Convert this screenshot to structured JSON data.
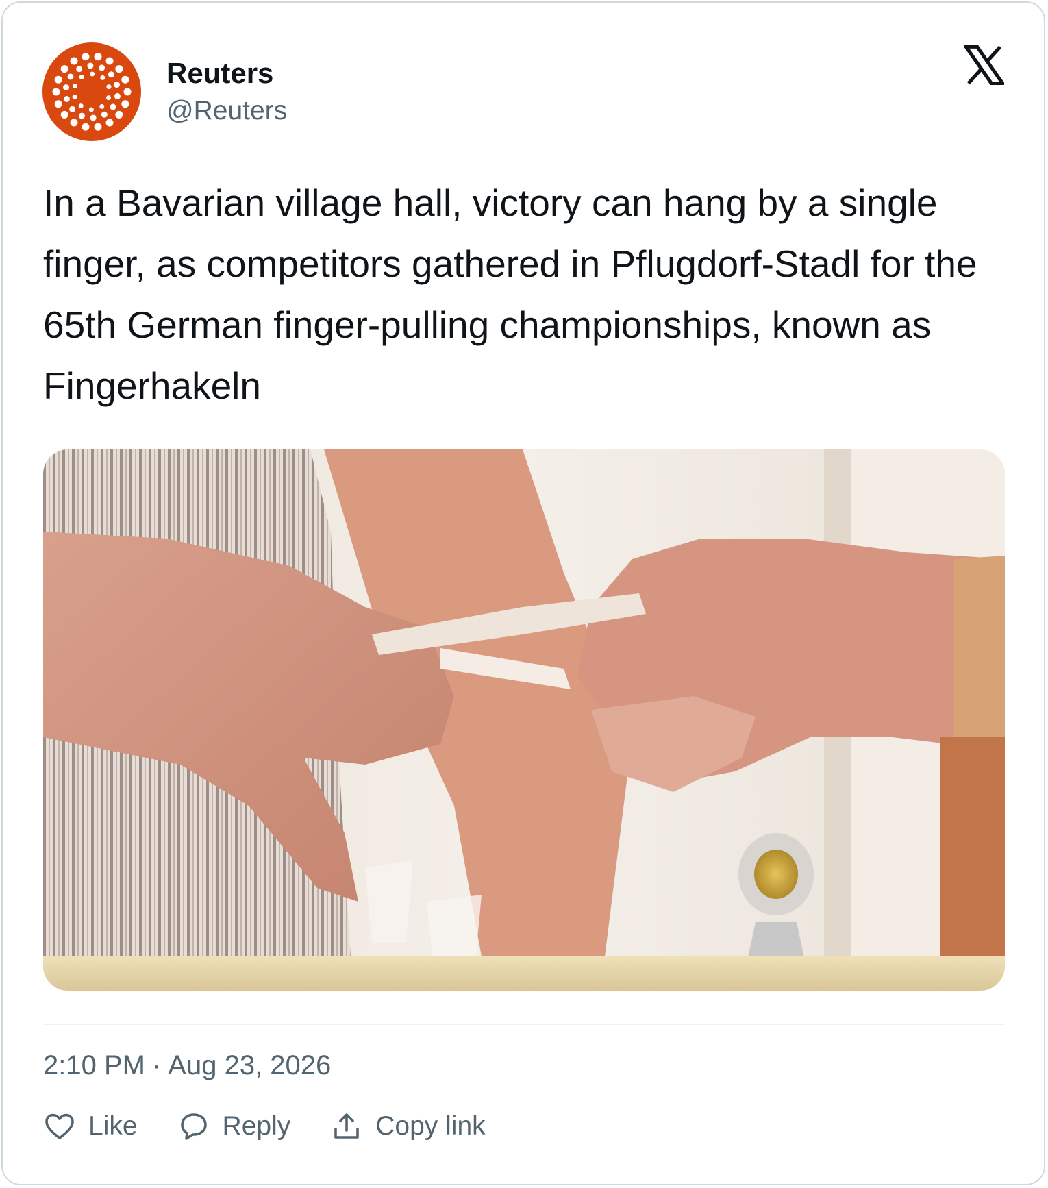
{
  "author": {
    "name": "Reuters",
    "handle": "@Reuters",
    "avatar_icon": "reuters-dots-logo",
    "avatar_color": "#d9480f"
  },
  "platform_icon": "x-logo-icon",
  "tweet": {
    "text": "In a Bavarian village hall, victory can hang by a single finger, as competitors gathered in Pflugdorf-Stadl for the 65th German finger-pulling championships, known as Fingerhakeln"
  },
  "meta": {
    "time": "2:10 PM",
    "separator": "·",
    "date": "Aug 23, 2026"
  },
  "actions": {
    "like_label": "Like",
    "like_icon": "heart-icon",
    "reply_label": "Reply",
    "reply_icon": "speech-bubble-icon",
    "copy_label": "Copy link",
    "copy_icon": "upload-share-icon"
  },
  "colors": {
    "text_primary": "#0f1419",
    "text_secondary": "#536471",
    "border": "#cfd9de"
  }
}
